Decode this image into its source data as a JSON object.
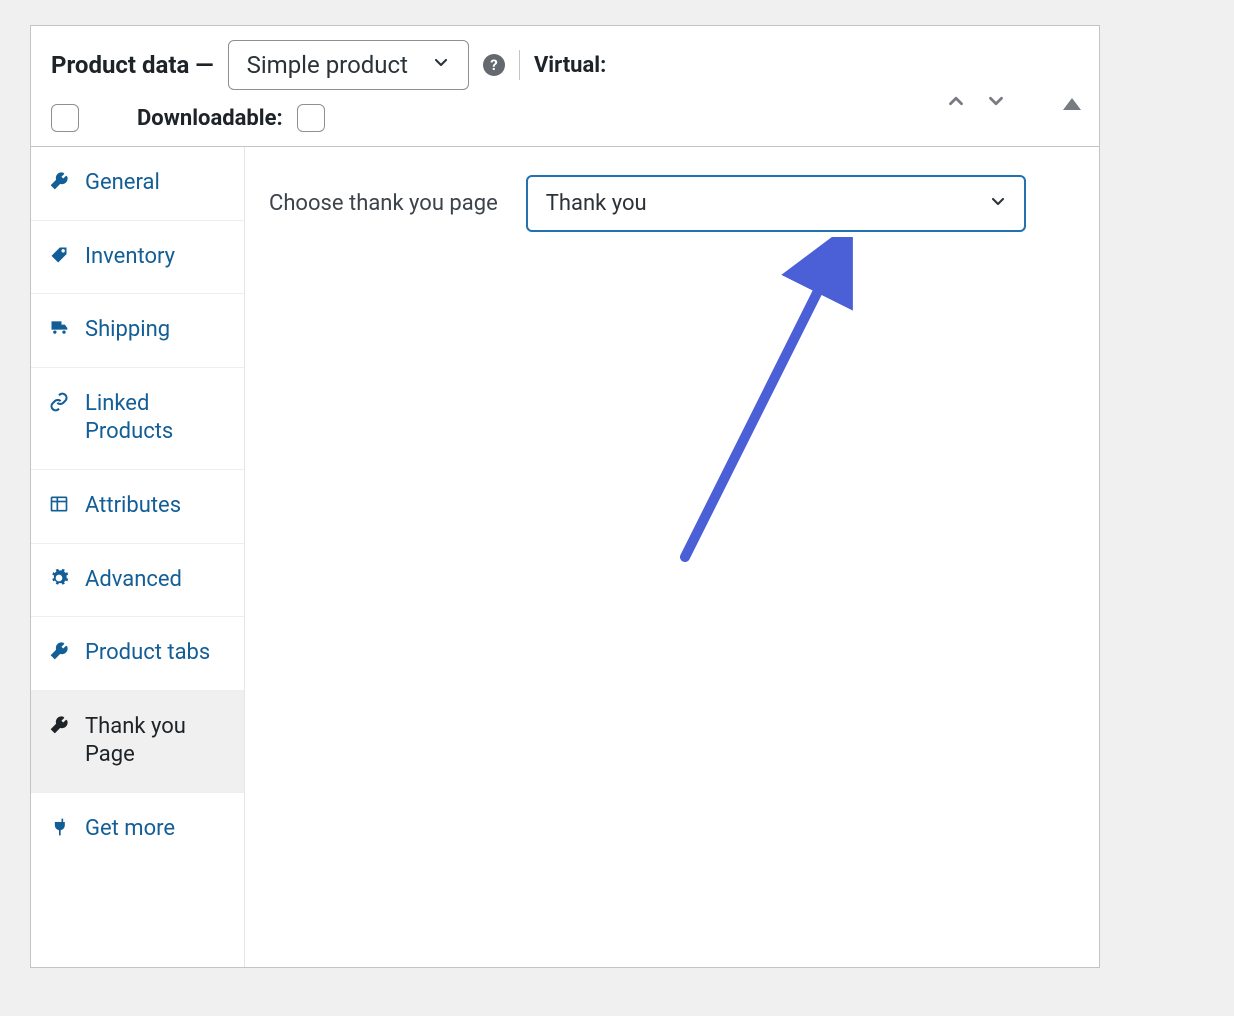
{
  "header": {
    "title_prefix": "Product data —",
    "product_type": "Simple product",
    "virtual_label": "Virtual:",
    "downloadable_label": "Downloadable:"
  },
  "tabs": [
    {
      "label": "General",
      "icon": "wrench"
    },
    {
      "label": "Inventory",
      "icon": "tag"
    },
    {
      "label": "Shipping",
      "icon": "truck"
    },
    {
      "label": "Linked Products",
      "icon": "link"
    },
    {
      "label": "Attributes",
      "icon": "list"
    },
    {
      "label": "Advanced",
      "icon": "gear"
    },
    {
      "label": "Product tabs",
      "icon": "wrench"
    },
    {
      "label": "Thank you Page",
      "icon": "wrench",
      "active": true
    },
    {
      "label": "Get more",
      "icon": "plug"
    }
  ],
  "content": {
    "choose_label": "Choose thank you page",
    "selected_page": "Thank you"
  }
}
